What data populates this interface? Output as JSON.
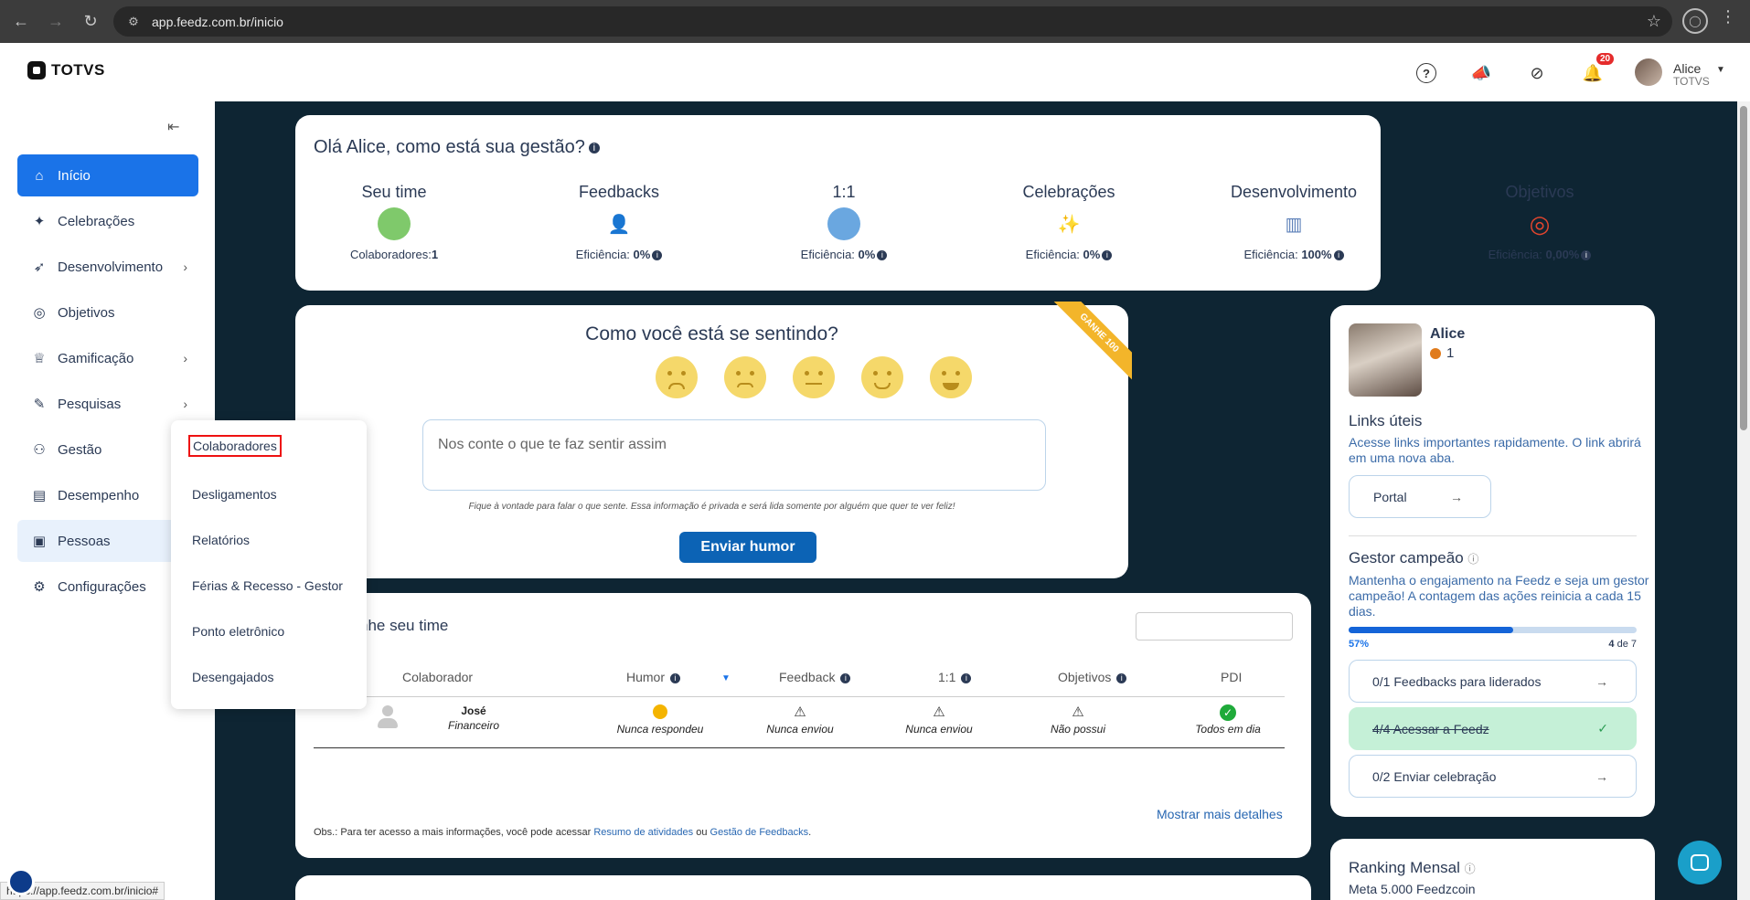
{
  "browser": {
    "url": "app.feedz.com.br/inicio",
    "status_url": "https://app.feedz.com.br/inicio#"
  },
  "header": {
    "logo_text": "TOTVS",
    "notifications_count": "20",
    "user_name": "Alice",
    "user_company": "TOTVS"
  },
  "sidebar": {
    "items": [
      {
        "label": "Início",
        "icon": "home-icon"
      },
      {
        "label": "Celebrações",
        "icon": "party-icon"
      },
      {
        "label": "Desenvolvimento",
        "icon": "rocket-icon"
      },
      {
        "label": "Objetivos",
        "icon": "target-icon"
      },
      {
        "label": "Gamificação",
        "icon": "trophy-icon"
      },
      {
        "label": "Pesquisas",
        "icon": "survey-icon"
      },
      {
        "label": "Gestão",
        "icon": "team-icon"
      },
      {
        "label": "Desempenho",
        "icon": "chart-icon"
      },
      {
        "label": "Pessoas",
        "icon": "people-icon"
      },
      {
        "label": "Configurações",
        "icon": "gear-icon"
      }
    ]
  },
  "dropdown": {
    "items": [
      "Colaboradores",
      "Desligamentos",
      "Relatórios",
      "Férias & Recesso - Gestor",
      "Ponto eletrônico",
      "Desengajados"
    ]
  },
  "stats": {
    "greeting": "Olá Alice, como está sua gestão?",
    "items": [
      {
        "title": "Seu time",
        "label": "Colaboradores:",
        "value": "1"
      },
      {
        "title": "Feedbacks",
        "label": "Eficiência: ",
        "value": "0%"
      },
      {
        "title": "1:1",
        "label": "Eficiência: ",
        "value": "0%"
      },
      {
        "title": "Celebrações",
        "label": "Eficiência: ",
        "value": "0%"
      },
      {
        "title": "Desenvolvimento",
        "label": "Eficiência: ",
        "value": "100%"
      },
      {
        "title": "Objetivos",
        "label": "Eficiência: ",
        "value": "0,00%"
      }
    ]
  },
  "mood": {
    "title": "Como você está se sentindo?",
    "ribbon": "GANHE 100",
    "placeholder": "Nos conte o que te faz sentir assim",
    "note": "Fique à vontade para falar o que sente. Essa informação é privada e será lida somente por alguém que quer te ver feliz!",
    "button": "Enviar humor"
  },
  "team": {
    "title": "nhe seu time",
    "columns": [
      "Colaborador",
      "Humor",
      "Feedback",
      "1:1",
      "Objetivos",
      "PDI"
    ],
    "rows": [
      {
        "name": "José",
        "dept": "Financeiro",
        "humor": "Nunca respondeu",
        "feedback": "Nunca enviou",
        "one_on_one": "Nunca enviou",
        "objetivos": "Não possui",
        "pdi": "Todos em dia"
      }
    ],
    "more_details": "Mostrar mais detalhes",
    "obs_prefix": "Obs.: Para ter acesso a mais informações, você pode acessar ",
    "obs_link1": "Resumo de atividades",
    "obs_mid": " ou ",
    "obs_link2": "Gestão de Feedbacks",
    "obs_suffix": "."
  },
  "profile": {
    "name": "Alice",
    "coins": "1",
    "links_title": "Links úteis",
    "links_text": "Acesse links importantes rapidamente. O link abrirá em uma nova aba.",
    "portal_label": "Portal",
    "champion_title": "Gestor campeão",
    "champion_text": "Mantenha o engajamento na Feedz e seja um gestor campeão! A contagem das ações reinicia a cada 15 dias.",
    "progress_pct": "57%",
    "progress_fraction": 0.57,
    "progress_done": "4",
    "progress_total": "de 7",
    "tasks": [
      {
        "label": "0/1 Feedbacks para liderados",
        "done": false
      },
      {
        "label": "4/4 Acessar a Feedz",
        "done": true
      },
      {
        "label": "0/2 Enviar celebração",
        "done": false
      }
    ],
    "ranking_title": "Ranking Mensal",
    "ranking_sub": "Meta 5.000 Feedzcoin"
  }
}
